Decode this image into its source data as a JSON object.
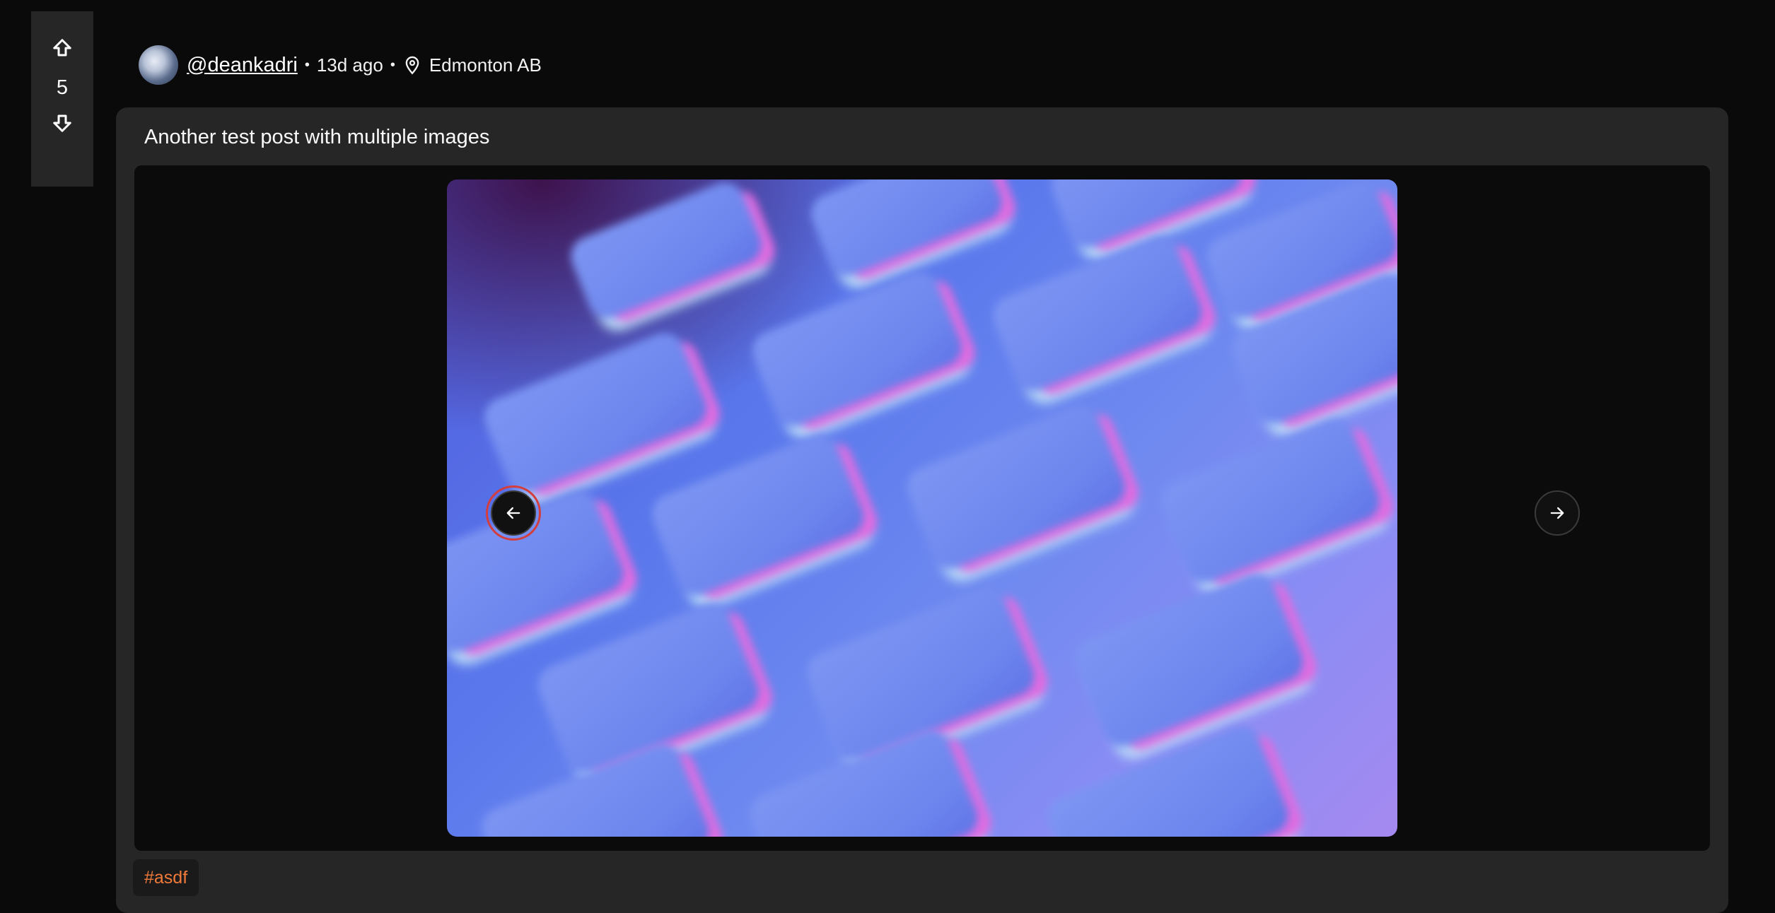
{
  "vote": {
    "count": "5",
    "upvote_icon": "arrow-up-outline-icon",
    "downvote_icon": "arrow-down-outline-icon"
  },
  "post": {
    "author": "@deankadri",
    "time_ago": "13d ago",
    "separator": "•",
    "location": "Edmonton AB",
    "title": "Another test post with multiple images",
    "tags": [
      "#asdf"
    ]
  },
  "carousel": {
    "prev_icon": "arrow-left-icon",
    "next_icon": "arrow-right-icon",
    "image_desc": "blurred close-up of a keyboard lit in blue and magenta"
  },
  "colors": {
    "accent_tag": "#f07a3a",
    "focus_ring": "#d53d3d",
    "card_bg": "#262626",
    "page_bg": "#0a0a0a"
  }
}
